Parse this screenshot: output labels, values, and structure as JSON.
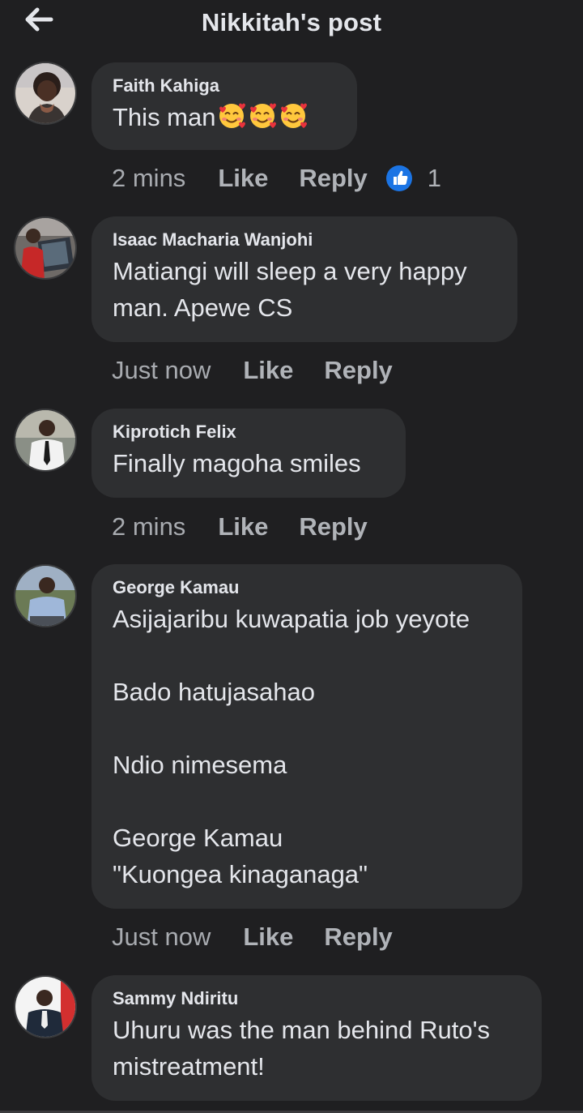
{
  "header": {
    "title": "Nikkitah's post",
    "back_icon": "arrow-left-icon"
  },
  "colors": {
    "background": "#1f1f21",
    "bubble": "#2e2f31",
    "like_blue": "#1b74e4"
  },
  "comments": [
    {
      "author": "Faith Kahiga",
      "text": "This man",
      "emoji": "smiling-face-with-hearts",
      "time": "2 mins",
      "like_label": "Like",
      "reply_label": "Reply",
      "reaction_count": "1"
    },
    {
      "author": "Isaac Macharia Wanjohi",
      "text": "Matiangi will sleep a very happy\nman. Apewe CS",
      "time": "Just now",
      "like_label": "Like",
      "reply_label": "Reply"
    },
    {
      "author": "Kiprotich Felix",
      "text": "Finally magoha smiles",
      "time": "2 mins",
      "like_label": "Like",
      "reply_label": "Reply"
    },
    {
      "author": "George Kamau",
      "text": "Asijajaribu kuwapatia job yeyote\n\nBado hatujasahao\n\nNdio nimesema\n\nGeorge Kamau\n\"Kuongea kinaganaga\"",
      "time": "Just now",
      "like_label": "Like",
      "reply_label": "Reply"
    },
    {
      "author": "Sammy Ndiritu",
      "text": "Uhuru was the man behind Ruto's\nmistreatment!"
    }
  ]
}
